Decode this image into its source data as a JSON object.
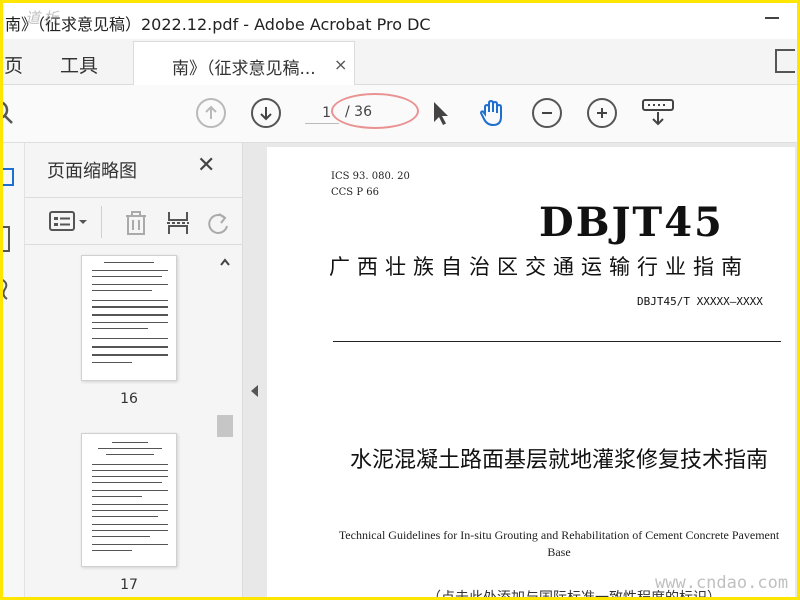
{
  "window": {
    "title": "南》（征求意见稿）2022.12.pdf - Adobe Acrobat Pro DC",
    "watermark_top": "道析",
    "watermark_bottom": "www.cndao.com"
  },
  "tabs": {
    "home_partial": "主页",
    "tools": "工具",
    "document": "南》（征求意见稿...",
    "close": "×"
  },
  "toolbar": {
    "current_page": "1",
    "total_pages": "/ 36"
  },
  "thumbnails_panel": {
    "title": "页面缩略图",
    "close": "✕",
    "pages": [
      {
        "number": "16"
      },
      {
        "number": "17"
      }
    ]
  },
  "document": {
    "ics": "ICS  93. 080. 20",
    "ccs": "CCS  P  66",
    "standard_code": "DBJT45",
    "guide_title_cn": "广西壮族自治区交通运输行业指南",
    "standard_number": "DBJT45/T XXXXX—XXXX",
    "title_cn": "水泥混凝土路面基层就地灌浆修复技术指南",
    "title_en": "Technical Guidelines for In-situ Grouting and Rehabilitation of Cement Concrete Pavement Base",
    "bottom_note": "（点击此处添加与国际标准一致性程度的标识）"
  },
  "colors": {
    "frame": "#ffe600",
    "accent_blue": "#1f6fd1",
    "highlight_circle": "#e67878"
  }
}
